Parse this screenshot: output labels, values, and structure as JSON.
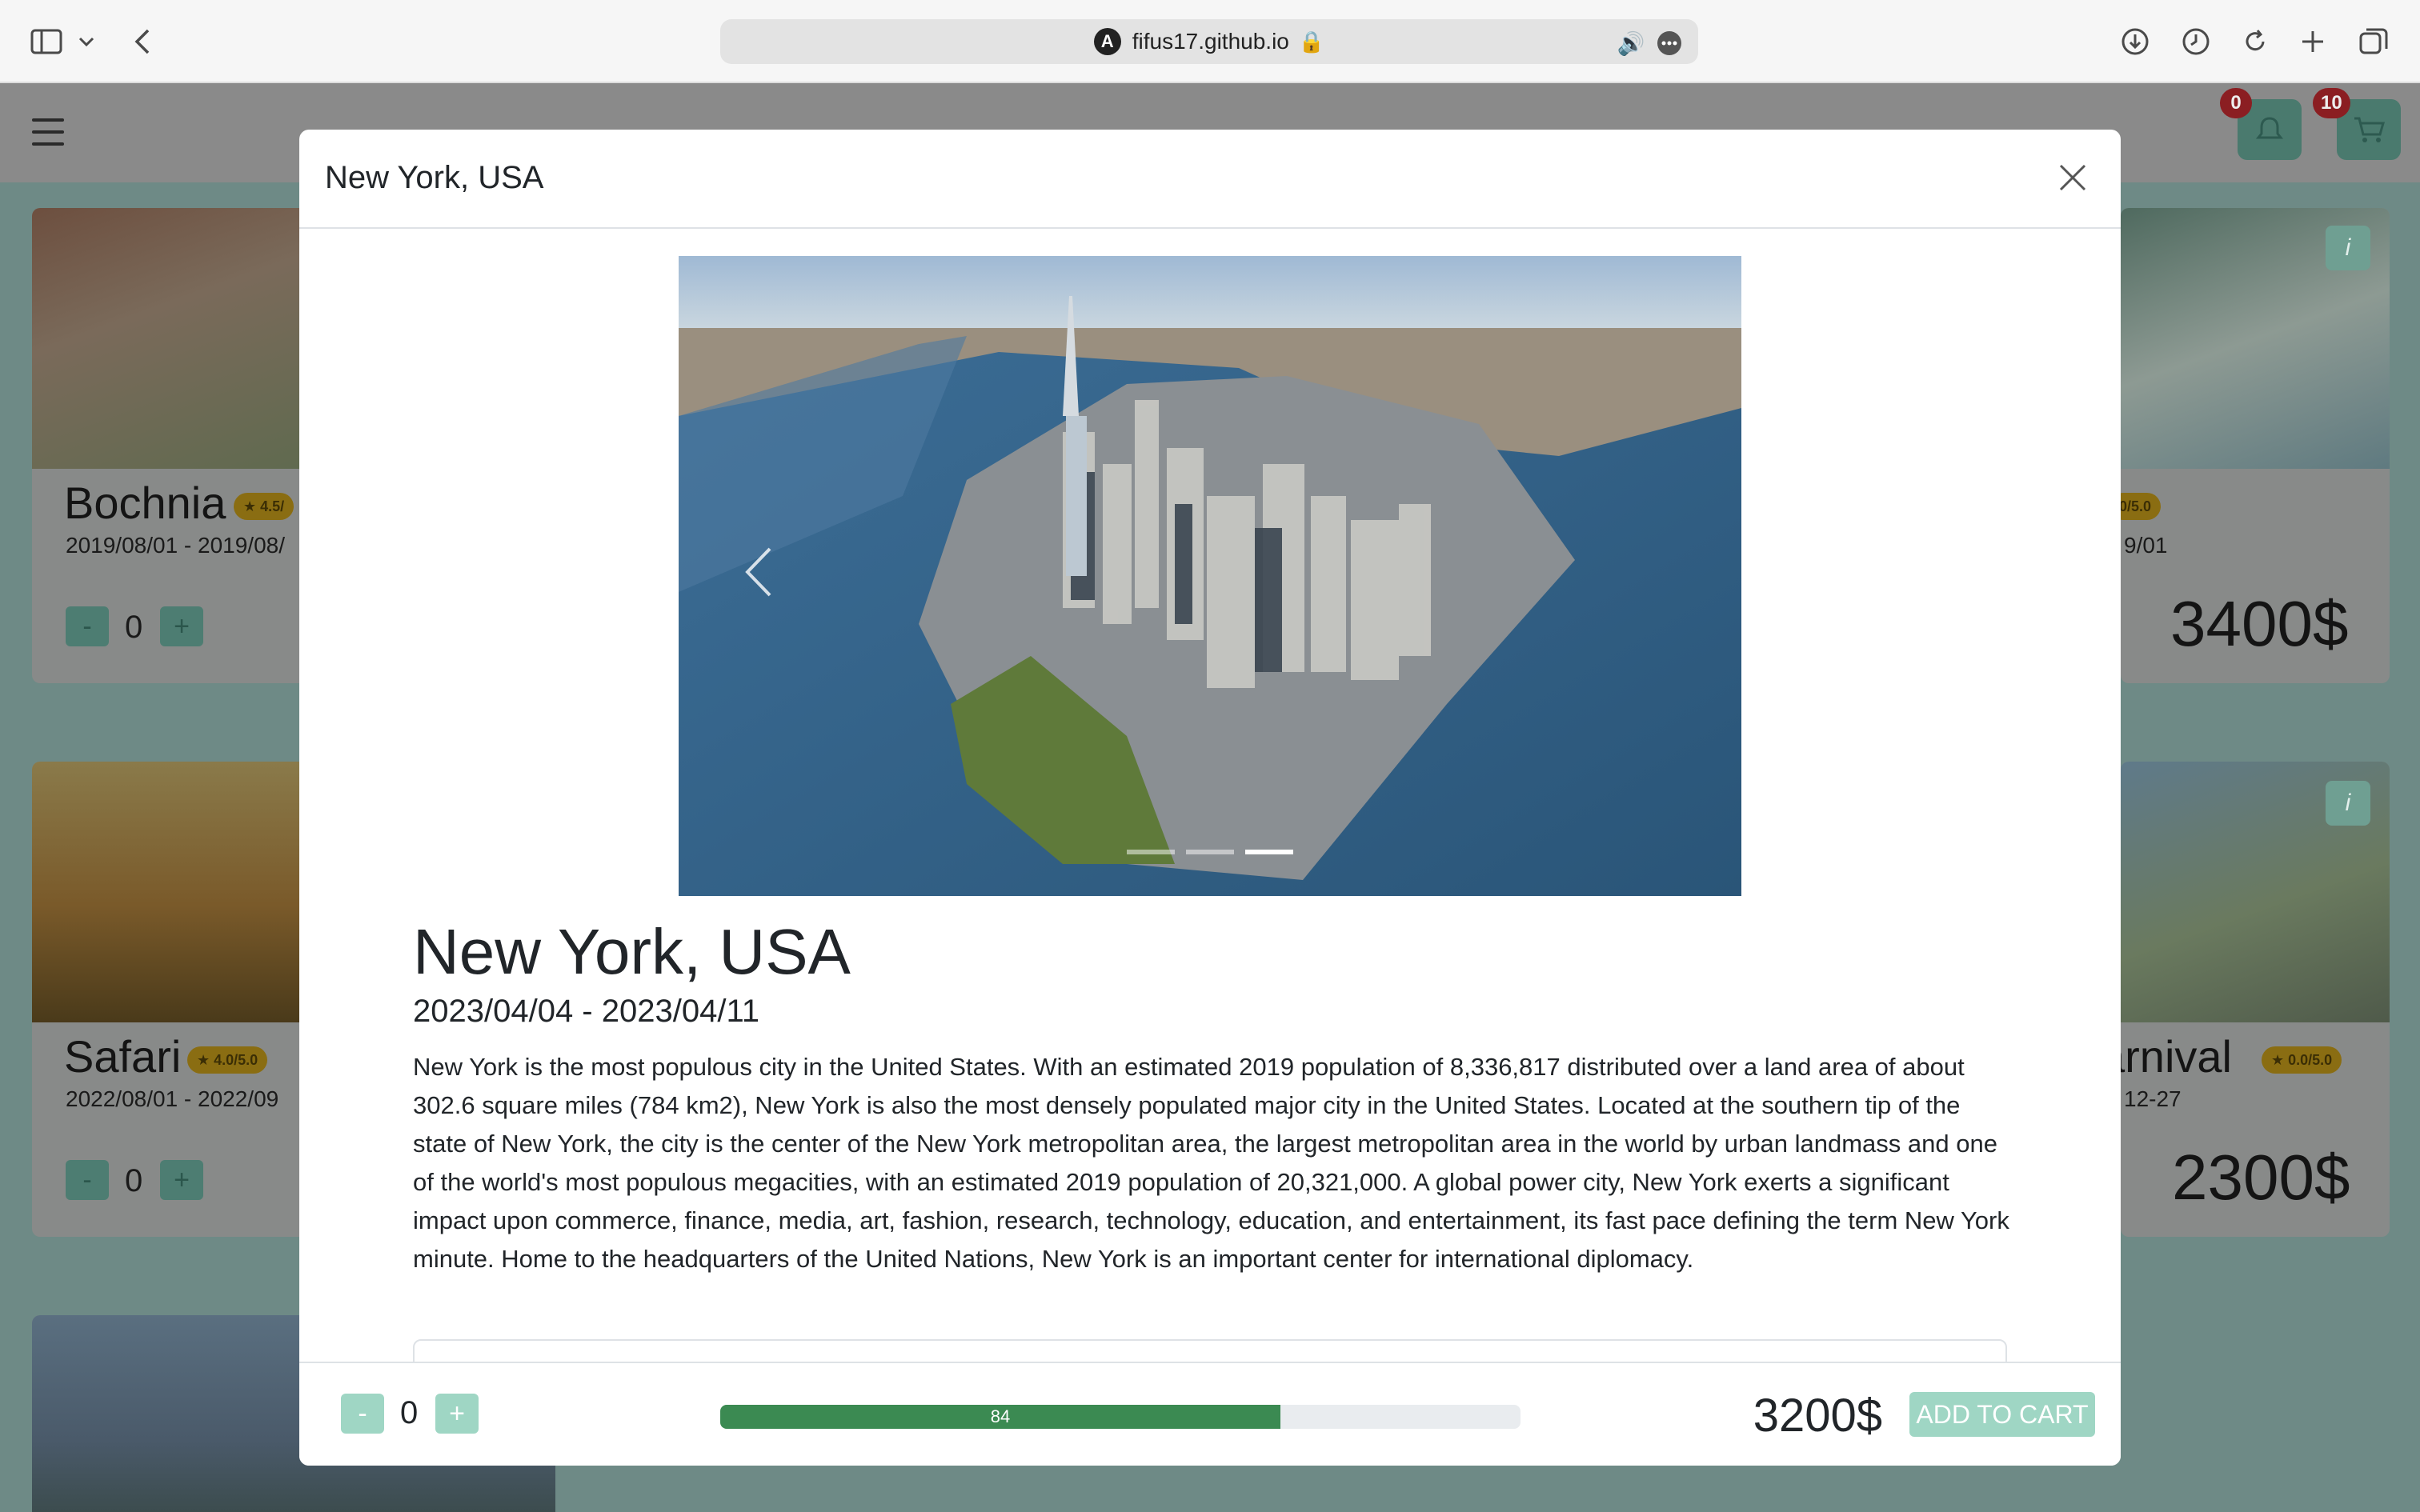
{
  "browser": {
    "url": "fifus17.github.io"
  },
  "nav": {
    "notifications_count": "0",
    "cart_count": "10"
  },
  "background_cards": [
    {
      "title": "Bochnia",
      "rating": "★ 4.5/",
      "dates": "2019/08/01 - 2019/08/",
      "qty": "0"
    },
    {
      "title": "",
      "rating": "0/5.0",
      "dates": "9/01",
      "price": "3400$"
    },
    {
      "title": "Safari",
      "rating": "★ 4.0/5.0",
      "dates": "2022/08/01 - 2022/09",
      "qty": "0"
    },
    {
      "title": "arnival",
      "rating": "★ 0.0/5.0",
      "dates": "12-27",
      "price": "2300$"
    }
  ],
  "modal": {
    "title": "New York, USA",
    "name": "New York, USA",
    "dates": "2023/04/04 - 2023/04/11",
    "description": "New York is the most populous city in the United States. With an estimated 2019 population of 8,336,817 distributed over a land area of about 302.6 square miles (784 km2), New York is also the most densely populated major city in the United States. Located at the southern tip of the state of New York, the city is the center of the New York metropolitan area, the largest metropolitan area in the world by urban landmass and one of the world's most populous megacities, with an estimated 2019 population of 20,321,000. A global power city, New York exerts a significant impact upon commerce, finance, media, art, fashion, research, technology, education, and entertainment, its fast pace defining the term New York minute. Home to the headquarters of the United Nations, New York is an important center for international diplomacy.",
    "footer": {
      "minus_label": "-",
      "plus_label": "+",
      "quantity": "0",
      "progress_label": "84",
      "progress_fraction": 0.7,
      "price": "3200$",
      "add_to_cart_label": "ADD TO CART"
    }
  },
  "card_buttons": {
    "minus": "-",
    "plus": "+",
    "info": "i"
  },
  "colors": {
    "accent": "#9fd6c4",
    "progress": "#3b8a52",
    "badge": "#b32a2f",
    "rating": "#f0c419"
  }
}
